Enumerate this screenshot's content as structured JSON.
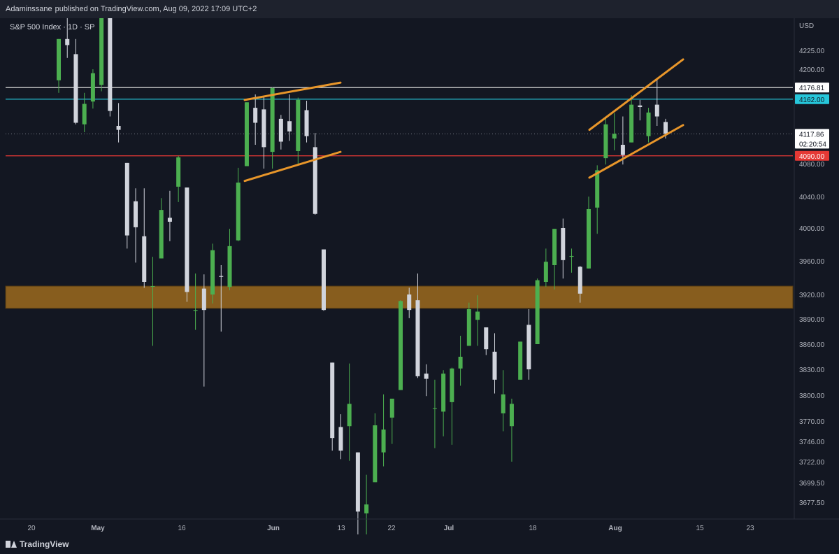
{
  "header": {
    "author": "Adaminssane",
    "published_text": "published on TradingView.com, Aug 09, 2022 17:09 UTC+2"
  },
  "legend": {
    "symbol_text": "S&P 500 Index · 1D · SP"
  },
  "footer": {
    "brand": "TradingView"
  },
  "colors": {
    "background": "#131722",
    "up": "#4caf50",
    "down": "#d1d4dc",
    "zone": "#9c6a1e",
    "trendline": "#e8962a",
    "resistance_cyan": "#26c6da",
    "support_red": "#e53935",
    "high_white": "#e0e0e0"
  },
  "chart_data": {
    "type": "candlestick",
    "currency": "USD",
    "ylim": [
      3660,
      4265
    ],
    "y_ticks": [
      {
        "v": 4225,
        "label": "4225.00"
      },
      {
        "v": 4200,
        "label": "4200.00"
      },
      {
        "v": 4080,
        "label": "4080.00"
      },
      {
        "v": 4040,
        "label": "4040.00"
      },
      {
        "v": 4000,
        "label": "4000.00"
      },
      {
        "v": 3960,
        "label": "3960.00"
      },
      {
        "v": 3920,
        "label": "3920.00"
      },
      {
        "v": 3890,
        "label": "3890.00"
      },
      {
        "v": 3860,
        "label": "3860.00"
      },
      {
        "v": 3830,
        "label": "3830.00"
      },
      {
        "v": 3800,
        "label": "3800.00"
      },
      {
        "v": 3770,
        "label": "3770.00"
      },
      {
        "v": 3746,
        "label": "3746.00"
      },
      {
        "v": 3722,
        "label": "3722.00"
      },
      {
        "v": 3699.5,
        "label": "3699.50"
      },
      {
        "v": 3677.5,
        "label": "3677.50"
      }
    ],
    "x_ticks": [
      "20",
      "May",
      "16",
      "Jun",
      "13",
      "22",
      "Jul",
      "18",
      "Aug",
      "15",
      "23"
    ],
    "x_tick_index": [
      0,
      10,
      26,
      38,
      49,
      60,
      71,
      82,
      95,
      108,
      119
    ],
    "horizontal_lines": [
      {
        "name": "high",
        "value": 4176.81,
        "label": "4176.81",
        "color": "#e0e0e0"
      },
      {
        "name": "resistance",
        "value": 4162.0,
        "label": "4162.00",
        "color": "#26c6da"
      },
      {
        "name": "current",
        "value": 4117.86,
        "label": "4117.86",
        "color": "#787b86",
        "countdown": "02:20:54"
      },
      {
        "name": "support",
        "value": 4090.0,
        "label": "4090.00",
        "color": "#e53935"
      }
    ],
    "zone": {
      "from": 3903,
      "to": 3930
    },
    "trendlines": [
      {
        "name": "jun-upper",
        "from": [
          "Jun 1",
          4161
        ],
        "to": [
          "Jun 10",
          4183
        ]
      },
      {
        "name": "jun-lower",
        "from": [
          "Jun 1",
          4059
        ],
        "to": [
          "Jun 10",
          4095
        ]
      },
      {
        "name": "aug-upper",
        "from": [
          "Jul 27",
          4123
        ],
        "to": [
          "Aug 11",
          4213
        ]
      },
      {
        "name": "aug-lower",
        "from": [
          "Jul 27",
          4063
        ],
        "to": [
          "Aug 11",
          4129
        ]
      }
    ],
    "candles": [
      {
        "date": "Apr 27",
        "o": 4186,
        "h": 4240,
        "l": 4170,
        "c": 4240
      },
      {
        "date": "Apr 28",
        "o": 4240,
        "h": 4280,
        "l": 4215,
        "c": 4232
      },
      {
        "date": "Apr 29",
        "o": 4220,
        "h": 4240,
        "l": 4130,
        "c": 4132
      },
      {
        "date": "May 2",
        "o": 4130,
        "h": 4170,
        "l": 4120,
        "c": 4156
      },
      {
        "date": "May 3",
        "o": 4159,
        "h": 4200,
        "l": 4150,
        "c": 4195
      },
      {
        "date": "May 4",
        "o": 4180,
        "h": 4276,
        "l": 4172,
        "c": 4276
      },
      {
        "date": "May 5",
        "o": 4270,
        "h": 4275,
        "l": 4140,
        "c": 4147
      },
      {
        "date": "May 6",
        "o": 4128,
        "h": 4157,
        "l": 4107,
        "c": 4123
      },
      {
        "date": "May 9",
        "o": 4081,
        "h": 4081,
        "l": 3975,
        "c": 3991
      },
      {
        "date": "May 10",
        "o": 4034,
        "h": 4050,
        "l": 3958,
        "c": 4001
      },
      {
        "date": "May 11",
        "o": 3990,
        "h": 4050,
        "l": 3928,
        "c": 3935
      },
      {
        "date": "May 12",
        "o": 3930,
        "h": 3965,
        "l": 3858,
        "c": 3930
      },
      {
        "date": "May 13",
        "o": 3963,
        "h": 4038,
        "l": 3963,
        "c": 4023
      },
      {
        "date": "May 16",
        "o": 4013,
        "h": 4047,
        "l": 3984,
        "c": 4008
      },
      {
        "date": "May 17",
        "o": 4052,
        "h": 4090,
        "l": 4033,
        "c": 4088
      },
      {
        "date": "May 18",
        "o": 4051,
        "h": 4051,
        "l": 3911,
        "c": 3923
      },
      {
        "date": "May 19",
        "o": 3900,
        "h": 3945,
        "l": 3877,
        "c": 3901
      },
      {
        "date": "May 20",
        "o": 3927,
        "h": 3944,
        "l": 3810,
        "c": 3901
      },
      {
        "date": "May 23",
        "o": 3920,
        "h": 3981,
        "l": 3909,
        "c": 3973
      },
      {
        "date": "May 24",
        "o": 3942,
        "h": 3955,
        "l": 3875,
        "c": 3941
      },
      {
        "date": "May 25",
        "o": 3929,
        "h": 3999,
        "l": 3925,
        "c": 3978
      },
      {
        "date": "May 26",
        "o": 3985,
        "h": 4075,
        "l": 3984,
        "c": 4057
      },
      {
        "date": "May 27",
        "o": 4077,
        "h": 4158,
        "l": 4077,
        "c": 4158
      },
      {
        "date": "May 31",
        "o": 4151,
        "h": 4168,
        "l": 4104,
        "c": 4132
      },
      {
        "date": "Jun 1",
        "o": 4149,
        "h": 4166,
        "l": 4074,
        "c": 4101
      },
      {
        "date": "Jun 2",
        "o": 4095,
        "h": 4177,
        "l": 4074,
        "c": 4176
      },
      {
        "date": "Jun 3",
        "o": 4137,
        "h": 4142,
        "l": 4098,
        "c": 4108
      },
      {
        "date": "Jun 6",
        "o": 4134,
        "h": 4168,
        "l": 4109,
        "c": 4121
      },
      {
        "date": "Jun 7",
        "o": 4096,
        "h": 4164,
        "l": 4080,
        "c": 4161
      },
      {
        "date": "Jun 8",
        "o": 4148,
        "h": 4160,
        "l": 4107,
        "c": 4115
      },
      {
        "date": "Jun 9",
        "o": 4101,
        "h": 4119,
        "l": 4017,
        "c": 4018
      },
      {
        "date": "Jun 10",
        "o": 3974,
        "h": 3974,
        "l": 3900,
        "c": 3901
      },
      {
        "date": "Jun 13",
        "o": 3838,
        "h": 3838,
        "l": 3735,
        "c": 3750
      },
      {
        "date": "Jun 14",
        "o": 3763,
        "h": 3778,
        "l": 3725,
        "c": 3735
      },
      {
        "date": "Jun 15",
        "o": 3764,
        "h": 3837,
        "l": 3723,
        "c": 3790
      },
      {
        "date": "Jun 16",
        "o": 3733,
        "h": 3733,
        "l": 3640,
        "c": 3667
      },
      {
        "date": "Jun 17",
        "o": 3665,
        "h": 3708,
        "l": 3639,
        "c": 3675
      },
      {
        "date": "Jun 21",
        "o": 3700,
        "h": 3779,
        "l": 3700,
        "c": 3765
      },
      {
        "date": "Jun 22",
        "o": 3733,
        "h": 3801,
        "l": 3717,
        "c": 3760
      },
      {
        "date": "Jun 23",
        "o": 3774,
        "h": 3796,
        "l": 3743,
        "c": 3796
      },
      {
        "date": "Jun 24",
        "o": 3806,
        "h": 3913,
        "l": 3806,
        "c": 3912
      },
      {
        "date": "Jun 27",
        "o": 3920,
        "h": 3928,
        "l": 3891,
        "c": 3901
      },
      {
        "date": "Jun 28",
        "o": 3913,
        "h": 3945,
        "l": 3820,
        "c": 3822
      },
      {
        "date": "Jun 29",
        "o": 3825,
        "h": 3836,
        "l": 3799,
        "c": 3819
      },
      {
        "date": "Jun 30",
        "o": 3785,
        "h": 3818,
        "l": 3738,
        "c": 3785
      },
      {
        "date": "Jul 1",
        "o": 3781,
        "h": 3829,
        "l": 3752,
        "c": 3825
      },
      {
        "date": "Jul 5",
        "o": 3792,
        "h": 3832,
        "l": 3742,
        "c": 3831
      },
      {
        "date": "Jul 6",
        "o": 3831,
        "h": 3870,
        "l": 3811,
        "c": 3845
      },
      {
        "date": "Jul 7",
        "o": 3858,
        "h": 3910,
        "l": 3858,
        "c": 3902
      },
      {
        "date": "Jul 8",
        "o": 3889,
        "h": 3919,
        "l": 3858,
        "c": 3899
      },
      {
        "date": "Jul 11",
        "o": 3880,
        "h": 3880,
        "l": 3847,
        "c": 3854
      },
      {
        "date": "Jul 12",
        "o": 3851,
        "h": 3873,
        "l": 3802,
        "c": 3818
      },
      {
        "date": "Jul 13",
        "o": 3779,
        "h": 3829,
        "l": 3758,
        "c": 3801
      },
      {
        "date": "Jul 14",
        "o": 3764,
        "h": 3796,
        "l": 3722,
        "c": 3790
      },
      {
        "date": "Jul 15",
        "o": 3818,
        "h": 3863,
        "l": 3818,
        "c": 3863
      },
      {
        "date": "Jul 18",
        "o": 3883,
        "h": 3902,
        "l": 3818,
        "c": 3830
      },
      {
        "date": "Jul 19",
        "o": 3860,
        "h": 3939,
        "l": 3860,
        "c": 3937
      },
      {
        "date": "Jul 20",
        "o": 3935,
        "h": 3975,
        "l": 3929,
        "c": 3959
      },
      {
        "date": "Jul 21",
        "o": 3955,
        "h": 3999,
        "l": 3926,
        "c": 3999
      },
      {
        "date": "Jul 22",
        "o": 4000,
        "h": 4012,
        "l": 3939,
        "c": 3961
      },
      {
        "date": "Jul 25",
        "o": 3965,
        "h": 3975,
        "l": 3946,
        "c": 3966
      },
      {
        "date": "Jul 26",
        "o": 3953,
        "h": 3954,
        "l": 3910,
        "c": 3921
      },
      {
        "date": "Jul 27",
        "o": 3951,
        "h": 4040,
        "l": 3951,
        "c": 4024
      },
      {
        "date": "Jul 28",
        "o": 4026,
        "h": 4078,
        "l": 3993,
        "c": 4072
      },
      {
        "date": "Jul 29",
        "o": 4087,
        "h": 4140,
        "l": 4079,
        "c": 4130
      },
      {
        "date": "Aug 1",
        "o": 4112,
        "h": 4144,
        "l": 4097,
        "c": 4118
      },
      {
        "date": "Aug 2",
        "o": 4104,
        "h": 4140,
        "l": 4079,
        "c": 4091
      },
      {
        "date": "Aug 3",
        "o": 4107,
        "h": 4167,
        "l": 4107,
        "c": 4155
      },
      {
        "date": "Aug 4",
        "o": 4154,
        "h": 4161,
        "l": 4135,
        "c": 4152
      },
      {
        "date": "Aug 5",
        "o": 4115,
        "h": 4151,
        "l": 4107,
        "c": 4145
      },
      {
        "date": "Aug 8",
        "o": 4155,
        "h": 4187,
        "l": 4128,
        "c": 4140
      },
      {
        "date": "Aug 9",
        "o": 4133,
        "h": 4137,
        "l": 4112,
        "c": 4118
      }
    ]
  }
}
